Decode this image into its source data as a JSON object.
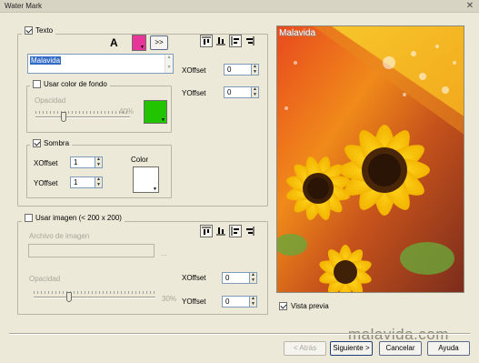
{
  "window": {
    "title": "Water Mark"
  },
  "text_group": {
    "label": "Texto",
    "checked": true,
    "font_glyph": "A",
    "color_hex": "#e8359a",
    "more_label": ">>",
    "text_value": "Malavida",
    "xoffset_label": "XOffset",
    "xoffset_value": "0",
    "yoffset_label": "YOffset",
    "yoffset_value": "0",
    "bg_group": {
      "label": "Usar color de fondo",
      "checked": false,
      "opacity_label": "Opacidad",
      "opacity_pct": "40%",
      "opacity_value": 0.4,
      "color_hex": "#22c400"
    },
    "shadow_group": {
      "label": "Sombra",
      "checked": true,
      "xoffset_label": "XOffset",
      "xoffset_value": "1",
      "yoffset_label": "YOffset",
      "yoffset_value": "1",
      "color_label": "Color",
      "color_hex": "#ffffff"
    }
  },
  "image_group": {
    "label": "Usar imagen (< 200 x 200)",
    "checked": false,
    "file_label": "Archivo de imagen",
    "browse_label": "...",
    "opacity_label": "Opacidad",
    "opacity_pct": "30%",
    "opacity_value": 0.3,
    "xoffset_label": "XOffset",
    "xoffset_value": "0",
    "yoffset_label": "YOffset",
    "yoffset_value": "0"
  },
  "preview": {
    "watermark_text": "Malavida",
    "checkbox_label": "Vista previa",
    "checked": true
  },
  "site_watermark": "malavida.com",
  "buttons": {
    "back": "< Atrás",
    "next": "Siguiente >",
    "cancel": "Cancelar",
    "help": "Ayuda"
  },
  "icons": [
    "align-top-icon",
    "align-bottom-icon",
    "align-left-icon",
    "align-right-icon"
  ]
}
